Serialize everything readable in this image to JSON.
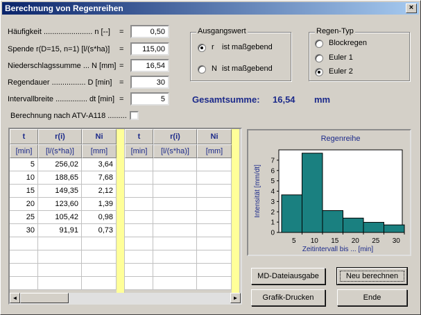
{
  "window": {
    "title": "Berechnung von Regenreihen",
    "close": "×"
  },
  "inputs": [
    {
      "label": "Häufigkeit ....................... n [--]",
      "eq": "=",
      "value": "0,50"
    },
    {
      "label": "Spende r(D=15, n=1)  [l/(s*ha)]",
      "eq": "=",
      "value": "115,00"
    },
    {
      "label": "Niederschlagssumme ... N [mm]",
      "eq": "=",
      "value": "16,54"
    },
    {
      "label": "Regendauer ................ D [min]",
      "eq": "=",
      "value": "30"
    },
    {
      "label": "Intervallbreite ............... dt [min]",
      "eq": "=",
      "value": "5"
    }
  ],
  "atv": {
    "label": "Berechnung nach ATV-A118 .........",
    "checked": false
  },
  "ausgangswert": {
    "caption": "Ausgangswert",
    "options": [
      {
        "letter": "r",
        "text": "ist maßgebend",
        "selected": true
      },
      {
        "letter": "N",
        "text": "ist maßgebend",
        "selected": false
      }
    ]
  },
  "regentyp": {
    "caption": "Regen-Typ",
    "options": [
      {
        "text": "Blockregen",
        "selected": false
      },
      {
        "text": "Euler 1",
        "selected": false
      },
      {
        "text": "Euler 2",
        "selected": true
      }
    ]
  },
  "total": {
    "label": "Gesamtsumme:",
    "value": "16,54",
    "unit": "mm"
  },
  "table": {
    "headers": [
      "t",
      "r(i)",
      "Ni",
      "t",
      "r(i)",
      "Ni"
    ],
    "units": [
      "[min]",
      "[l/(s*ha)]",
      "[mm]",
      "[min]",
      "[l/(s*ha)]",
      "[mm]"
    ],
    "rows": [
      [
        "5",
        "256,02",
        "3,64"
      ],
      [
        "10",
        "188,65",
        "7,68"
      ],
      [
        "15",
        "149,35",
        "2,12"
      ],
      [
        "20",
        "123,60",
        "1,39"
      ],
      [
        "25",
        "105,42",
        "0,98"
      ],
      [
        "30",
        "91,91",
        "0,73"
      ]
    ]
  },
  "chart_data": {
    "type": "bar",
    "title": "Regenreihe",
    "xlabel": "Zeitintervall bis ... [min]",
    "ylabel": "Intensität [mm/dt]",
    "categories": [
      "5",
      "10",
      "15",
      "20",
      "25",
      "30"
    ],
    "values": [
      3.64,
      7.68,
      2.12,
      1.39,
      0.98,
      0.73
    ],
    "yticks": [
      "0",
      "1",
      "2",
      "3",
      "4",
      "5",
      "6",
      "7"
    ],
    "ylim": [
      0,
      8
    ],
    "bar_color": "#1a8080",
    "legend": false
  },
  "buttons": {
    "md": "MD-Dateiausgabe",
    "neu": "Neu berechnen",
    "grafik": "Grafik-Drucken",
    "ende": "Ende"
  },
  "scroll": {
    "left": "◄",
    "right": "►"
  }
}
